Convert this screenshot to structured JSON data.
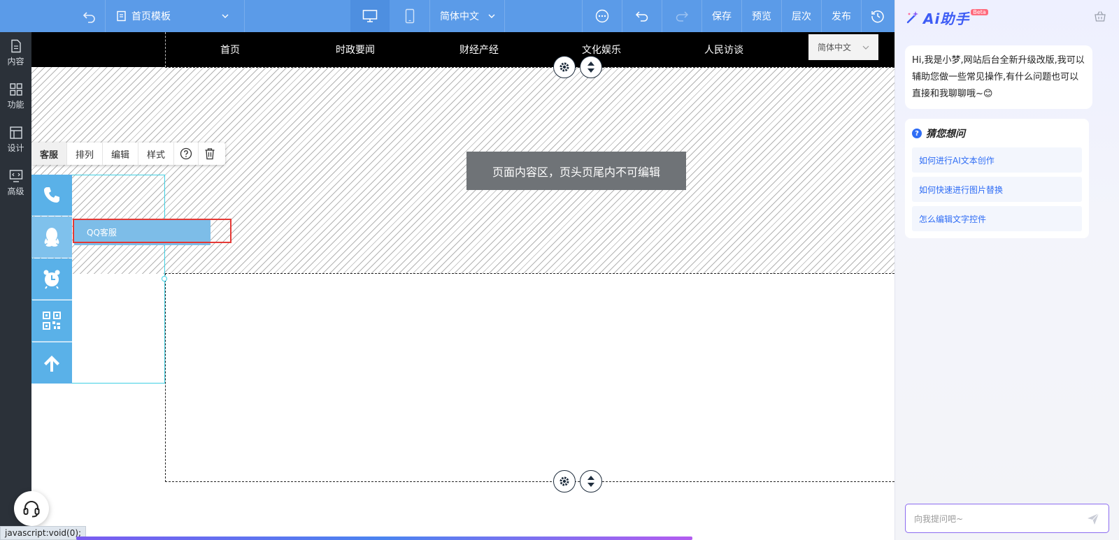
{
  "topbar": {
    "template_label": "首页模板",
    "language_label": "简体中文",
    "actions": {
      "save": "保存",
      "preview": "预览",
      "layers": "层次",
      "publish": "发布"
    }
  },
  "sidebar": {
    "items": [
      {
        "label": "内容",
        "icon": "document-icon"
      },
      {
        "label": "功能",
        "icon": "grid-icon"
      },
      {
        "label": "设计",
        "icon": "layout-icon"
      },
      {
        "label": "高级",
        "icon": "code-monitor-icon"
      }
    ]
  },
  "site_nav": {
    "items": [
      "首页",
      "时政要闻",
      "财经产经",
      "文化娱乐",
      "人民访谈"
    ],
    "language": "简体中文"
  },
  "content_area": {
    "banner_text": "页面内容区，页头页尾内不可编辑"
  },
  "cs_toolbar": {
    "tabs": [
      "客服",
      "排列",
      "编辑",
      "样式"
    ]
  },
  "cs_widget": {
    "popup_label": "QQ客服",
    "icons": [
      "phone-icon",
      "qq-icon",
      "alarm-clock-icon",
      "qrcode-icon",
      "arrow-up-icon"
    ]
  },
  "status": {
    "url": "javascript:void(0);"
  },
  "ai_panel": {
    "title": "Ai助手",
    "beta_badge": "Beta",
    "greeting": "Hi,我是小梦,网站后台全新升级改版,我可以辅助您做一些常见操作,有什么问题也可以直接和我聊聊哦~😊",
    "guess_title": "猜您想问",
    "questions": [
      "如何进行AI文本创作",
      "如何快速进行图片替换",
      "怎么编辑文字控件"
    ],
    "input_placeholder": "向我提问吧~"
  },
  "colors": {
    "topbar": "#5b9be8",
    "sidebar": "#2b3139",
    "accent": "#2f6df5",
    "widget_blue": "#5ab1e8",
    "highlight_red": "#e53935"
  }
}
